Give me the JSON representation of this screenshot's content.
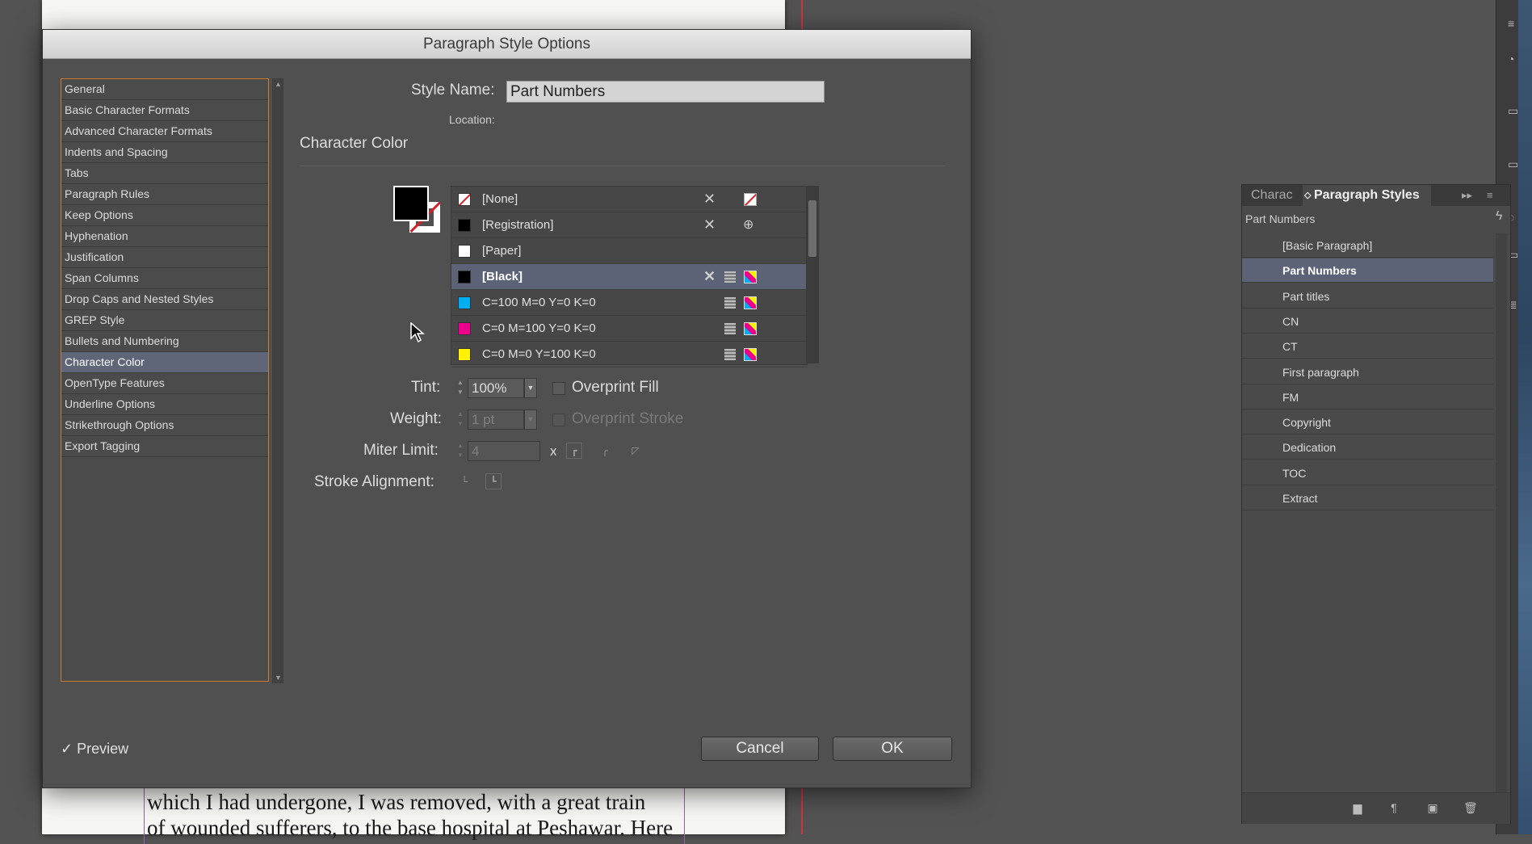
{
  "background": {
    "document_lines": [
      "which I had undergone, I was removed, with a great train",
      "of wounded sufferers, to the base hospital at Peshawar. Here"
    ]
  },
  "dialog": {
    "title": "Paragraph Style Options",
    "categories": [
      {
        "label": "General"
      },
      {
        "label": "Basic Character Formats"
      },
      {
        "label": "Advanced Character Formats"
      },
      {
        "label": "Indents and Spacing"
      },
      {
        "label": "Tabs"
      },
      {
        "label": "Paragraph Rules"
      },
      {
        "label": "Keep Options"
      },
      {
        "label": "Hyphenation"
      },
      {
        "label": "Justification"
      },
      {
        "label": "Span Columns"
      },
      {
        "label": "Drop Caps and Nested Styles"
      },
      {
        "label": "GREP Style"
      },
      {
        "label": "Bullets and Numbering"
      },
      {
        "label": "Character Color",
        "selected": true
      },
      {
        "label": "OpenType Features"
      },
      {
        "label": "Underline Options"
      },
      {
        "label": "Strikethrough Options"
      },
      {
        "label": "Export Tagging"
      }
    ],
    "style_name_label": "Style Name:",
    "style_name_value": "Part Numbers",
    "location_label": "Location:",
    "section_title": "Character Color",
    "swatches": [
      {
        "name": "[None]",
        "color": "none"
      },
      {
        "name": "[Registration]",
        "color": "#000000"
      },
      {
        "name": "[Paper]",
        "color": "#ffffff"
      },
      {
        "name": "[Black]",
        "color": "#000000",
        "selected": true
      },
      {
        "name": "C=100 M=0 Y=0 K=0",
        "color": "#00aeef"
      },
      {
        "name": "C=0 M=100 Y=0 K=0",
        "color": "#ec008c"
      },
      {
        "name": "C=0 M=0 Y=100 K=0",
        "color": "#fff200"
      }
    ],
    "tint_label": "Tint:",
    "tint_value": "100%",
    "overprint_fill_label": "Overprint Fill",
    "weight_label": "Weight:",
    "weight_value": "1 pt",
    "overprint_stroke_label": "Overprint Stroke",
    "miter_limit_label": "Miter Limit:",
    "miter_limit_value": "4",
    "miter_x": "x",
    "stroke_alignment_label": "Stroke Alignment:",
    "preview_label": "Preview",
    "preview_checked": true,
    "cancel_label": "Cancel",
    "ok_label": "OK"
  },
  "styles_panel": {
    "tab_character": "Charac",
    "tab_paragraph": "Paragraph Styles",
    "current_style": "Part Numbers",
    "items": [
      {
        "label": "[Basic Paragraph]"
      },
      {
        "label": "Part Numbers",
        "selected": true
      },
      {
        "label": "Part titles"
      },
      {
        "label": "CN"
      },
      {
        "label": "CT"
      },
      {
        "label": "First paragraph"
      },
      {
        "label": "FM"
      },
      {
        "label": "Copyright"
      },
      {
        "label": "Dedication"
      },
      {
        "label": "TOC"
      },
      {
        "label": "Extract"
      }
    ]
  },
  "colors": {
    "selection": "#5c6376",
    "list_border": "#d07a2c"
  }
}
